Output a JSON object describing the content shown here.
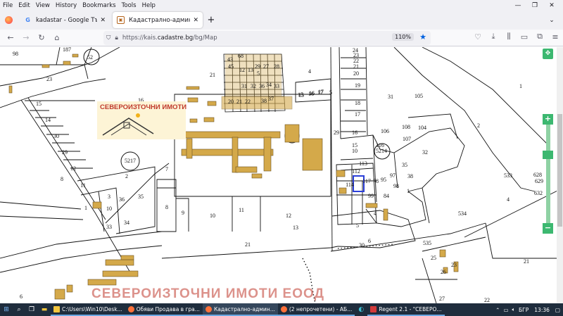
{
  "menubar": {
    "items": [
      "File",
      "Edit",
      "View",
      "History",
      "Bookmarks",
      "Tools",
      "Help"
    ]
  },
  "tabs": [
    {
      "label": "kadastar - Google Търсене",
      "icon": "google-icon"
    },
    {
      "label": "Кадастрално-административн",
      "icon": "cadastre-icon"
    }
  ],
  "navbar": {
    "url_prefix": "https://kais.",
    "url_domain": "cadastre.bg",
    "url_path": "/bg/Map",
    "zoom": "110%"
  },
  "map": {
    "logo_text": "СЕВЕРОИЗТОЧНИ ИМОТИ",
    "watermark": "СЕВЕРОИЗТОЧНИ ИМОТИ ЕООД",
    "colors": {
      "building": "#d4a94a",
      "selected": "#2b3fd8",
      "line": "#111111"
    },
    "labels": [
      {
        "t": "98"
      },
      {
        "t": "187"
      },
      {
        "t": "52"
      },
      {
        "t": "23"
      },
      {
        "t": "16"
      },
      {
        "t": "15"
      },
      {
        "t": "14"
      },
      {
        "t": "30"
      },
      {
        "t": "29"
      },
      {
        "t": "12"
      },
      {
        "t": "11"
      },
      {
        "t": "8"
      },
      {
        "t": "5217"
      },
      {
        "t": "21"
      },
      {
        "t": "7"
      },
      {
        "t": "2"
      },
      {
        "t": "1"
      },
      {
        "t": "3"
      },
      {
        "t": "10"
      },
      {
        "t": "36"
      },
      {
        "t": "35"
      },
      {
        "t": "34"
      },
      {
        "t": "33"
      },
      {
        "t": "8"
      },
      {
        "t": "9"
      },
      {
        "t": "10"
      },
      {
        "t": "11"
      },
      {
        "t": "12"
      },
      {
        "t": "13"
      },
      {
        "t": "21"
      },
      {
        "t": "4"
      },
      {
        "t": "15"
      },
      {
        "t": "16"
      },
      {
        "t": "17"
      },
      {
        "t": "5"
      },
      {
        "t": "24"
      },
      {
        "t": "23"
      },
      {
        "t": "22"
      },
      {
        "t": "21"
      },
      {
        "t": "20"
      },
      {
        "t": "19"
      },
      {
        "t": "18"
      },
      {
        "t": "17"
      },
      {
        "t": "16"
      },
      {
        "t": "29"
      },
      {
        "t": "15"
      },
      {
        "t": "10"
      },
      {
        "t": "31"
      },
      {
        "t": "105"
      },
      {
        "t": "1"
      },
      {
        "t": "106"
      },
      {
        "t": "108"
      },
      {
        "t": "104"
      },
      {
        "t": "107"
      },
      {
        "t": "2"
      },
      {
        "t": "5214"
      },
      {
        "t": "116"
      },
      {
        "t": "32"
      },
      {
        "t": "113"
      },
      {
        "t": "112"
      },
      {
        "t": "35"
      },
      {
        "t": "97"
      },
      {
        "t": "38"
      },
      {
        "t": "117"
      },
      {
        "t": "78"
      },
      {
        "t": "95"
      },
      {
        "t": "98"
      },
      {
        "t": "114"
      },
      {
        "t": "1"
      },
      {
        "t": "99"
      },
      {
        "t": "84"
      },
      {
        "t": "4"
      },
      {
        "t": "5"
      },
      {
        "t": "6"
      },
      {
        "t": "30"
      },
      {
        "t": "533"
      },
      {
        "t": "628"
      },
      {
        "t": "629"
      },
      {
        "t": "632"
      },
      {
        "t": "4"
      },
      {
        "t": "534"
      },
      {
        "t": "535"
      },
      {
        "t": "25"
      },
      {
        "t": "26"
      },
      {
        "t": "23"
      },
      {
        "t": "21"
      },
      {
        "t": "27"
      },
      {
        "t": "22"
      },
      {
        "t": "6"
      },
      {
        "t": "20"
      },
      {
        "t": "21"
      },
      {
        "t": "22"
      },
      {
        "t": "38"
      },
      {
        "t": "37"
      },
      {
        "t": "36"
      },
      {
        "t": "34"
      },
      {
        "t": "33"
      },
      {
        "t": "32"
      },
      {
        "t": "31"
      },
      {
        "t": "15"
      },
      {
        "t": "16"
      },
      {
        "t": "17"
      },
      {
        "t": "12"
      },
      {
        "t": "13"
      },
      {
        "t": "68"
      },
      {
        "t": "43"
      },
      {
        "t": "45"
      },
      {
        "t": "29"
      },
      {
        "t": "27"
      },
      {
        "t": "5"
      },
      {
        "t": "28"
      }
    ]
  },
  "taskbar": {
    "apps": [
      {
        "label": "C:\\Users\\Win10\\Desk...",
        "color": "#f2c53d"
      },
      {
        "label": "Обяви Продава в гра...",
        "color": "#ff7139"
      },
      {
        "label": "Кадастрално-админ...",
        "color": "#ff7139"
      },
      {
        "label": "(2 непрочетени) - АБ...",
        "color": "#ff7139"
      },
      {
        "label": "Regent 2.1 - \"СЕВЕРО...",
        "color": "#d23b3b"
      }
    ],
    "lang": "БГР",
    "time": "13:36"
  }
}
